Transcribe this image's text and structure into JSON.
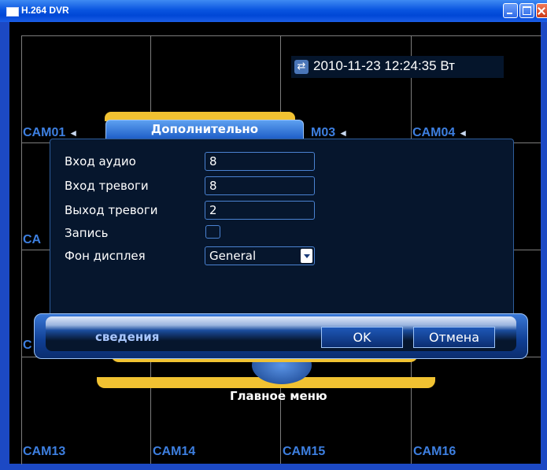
{
  "window": {
    "title": "H.264 DVR"
  },
  "overlay": {
    "datetime": "2010-11-23 12:24:35 Вт"
  },
  "cameras": {
    "cam01": "CAM01",
    "cam03_partial": "M03",
    "cam04": "CAM04",
    "cam05_partial": "CA",
    "cam09_partial": "C",
    "cam13": "CAM13",
    "cam14": "CAM14",
    "cam15": "CAM15",
    "cam16": "CAM16"
  },
  "main_menu": {
    "label": "Главное меню"
  },
  "dialog": {
    "title": "Дополнительно",
    "rows": [
      {
        "label": "Вход аудио",
        "value": "8"
      },
      {
        "label": "Вход тревоги",
        "value": "8"
      },
      {
        "label": "Выход тревоги",
        "value": "2"
      },
      {
        "label": "Запись",
        "checked": false
      },
      {
        "label": "Фон дисплея",
        "value": "General"
      }
    ],
    "footer_label": "сведения",
    "ok_label": "OK",
    "cancel_label": "Отмена"
  }
}
